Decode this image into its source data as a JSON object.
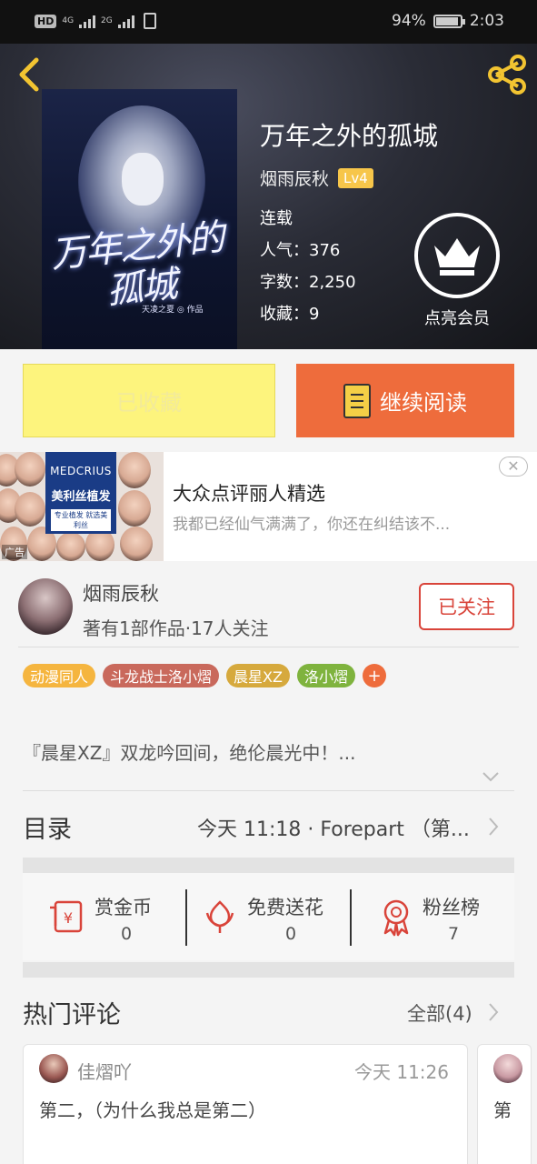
{
  "status_bar": {
    "hd": "HD",
    "net1": "4G",
    "net2": "2G",
    "battery_percent_text": "94%",
    "battery_level": 0.94,
    "time": "2:03"
  },
  "book": {
    "title": "万年之外的孤城",
    "cover_art_title": "万年之外的孤城",
    "cover_art_signature": "天凌之夏 ◎ 作品",
    "author": "烟雨辰秋",
    "level_badge": "Lv4",
    "status": "连载",
    "popularity": "人气：376",
    "word_count": "字数：2,250",
    "favorites": "收藏：9",
    "vip_label": "点亮会员"
  },
  "actions": {
    "collected_label": "已收藏",
    "continue_label": "继续阅读"
  },
  "ad": {
    "brand_en": "MEDCRIUS",
    "brand_cn": "美利丝植发",
    "brand_tag": "专业植发 就选美利丝",
    "tag": "广告",
    "title": "大众点评丽人精选",
    "description": "我都已经仙气满满了，你还在纠结该不...",
    "close_glyph": "✕"
  },
  "author_section": {
    "name": "烟雨辰秋",
    "info": "著有1部作品·17人关注",
    "follow_label": "已关注"
  },
  "tags": [
    {
      "label": "动漫同人",
      "color": "#f5b53f"
    },
    {
      "label": "斗龙战士洛小熠",
      "color": "#c9695c"
    },
    {
      "label": "晨星XZ",
      "color": "#d6a93d"
    },
    {
      "label": "洛小熠",
      "color": "#7fb33e"
    }
  ],
  "tag_more": "+",
  "description": "『晨星XZ』双龙吟回间，绝伦晨光中！...",
  "toc": {
    "label": "目录",
    "latest": "今天 11:18 · Forepart （第..."
  },
  "stats": [
    {
      "label": "赏金币",
      "value": "0",
      "icon": "red-envelope-icon"
    },
    {
      "label": "免费送花",
      "value": "0",
      "icon": "flower-icon"
    },
    {
      "label": "粉丝榜",
      "value": "7",
      "icon": "medal-icon"
    }
  ],
  "comments": {
    "label": "热门评论",
    "all_label": "全部(4)",
    "items": [
      {
        "user": "佳熠吖",
        "time": "今天 11:26",
        "text": "第二，（为什么我总是第二）"
      },
      {
        "user": "",
        "time": "",
        "text": "第"
      }
    ]
  },
  "colors": {
    "accent_orange": "#ee6c3c",
    "collected_yellow": "#fdf47d",
    "follow_red": "#d9443a",
    "icon_yellow": "#f2c431"
  }
}
